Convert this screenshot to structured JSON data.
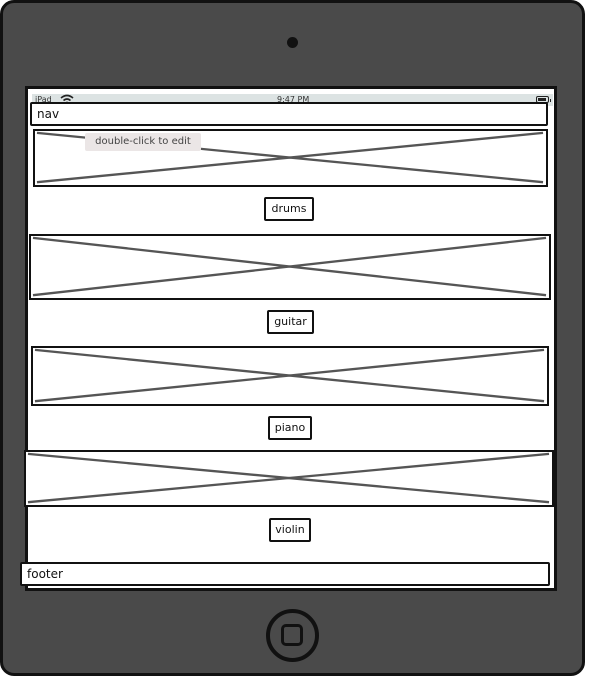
{
  "device": {
    "status_bar": {
      "carrier": "iPad",
      "time": "9:47 PM"
    }
  },
  "nav": {
    "label": "nav"
  },
  "tooltip": {
    "text": "double-click to edit"
  },
  "sections": [
    {
      "label": "drums"
    },
    {
      "label": "guitar"
    },
    {
      "label": "piano"
    },
    {
      "label": "violin"
    }
  ],
  "footer": {
    "label": "footer"
  },
  "icons": {
    "wifi": "wifi-icon",
    "battery": "battery-icon",
    "camera": "camera-icon",
    "home": "home-button-icon",
    "image_placeholder": "image-placeholder-icon"
  },
  "colors": {
    "device_body": "#4a4a4a",
    "outline": "#111111",
    "placeholder_cross": "#555555",
    "status_bar": "#dce3e3",
    "tooltip_bg": "#ebe6e6"
  }
}
